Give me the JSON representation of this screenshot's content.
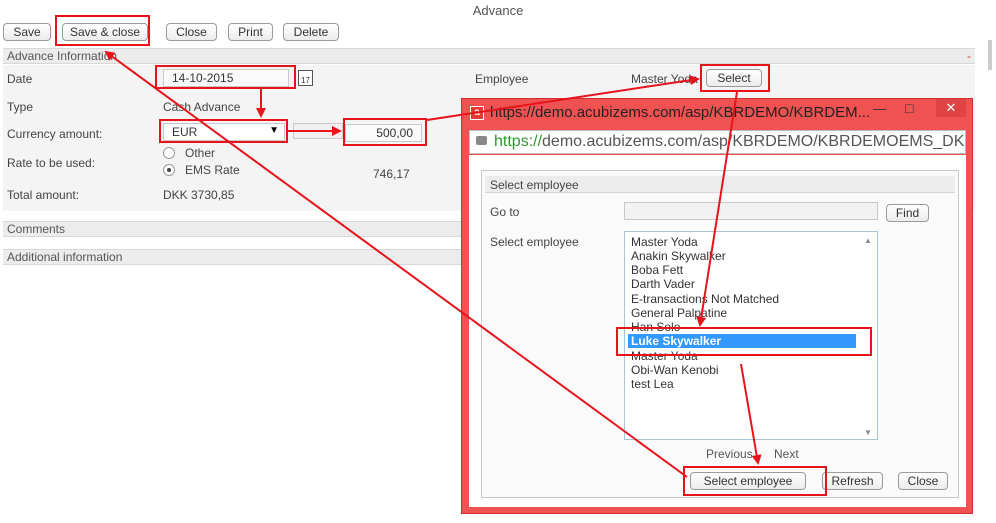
{
  "window": {
    "title": "Advance"
  },
  "toolbar": {
    "save": "Save",
    "save_close": "Save & close",
    "close": "Close",
    "print": "Print",
    "delete": "Delete"
  },
  "sections": {
    "advance_info": "Advance Information",
    "comments": "Comments",
    "additional_info": "Additional information",
    "collapse_symbol": "-"
  },
  "form": {
    "date_label": "Date",
    "date_value": "14-10-2015",
    "calendar_day": "17",
    "type_label": "Type",
    "type_value": "Cash Advance",
    "currency_label": "Currency amount:",
    "currency_value": "EUR",
    "amount_value": "500,00",
    "rate_label": "Rate to be used:",
    "rate_other": "Other",
    "rate_ems": "EMS Rate",
    "rate_value": "746,17",
    "total_label": "Total amount:",
    "total_value": "DKK 3730,85",
    "employee_label": "Employee",
    "employee_value": "Master Yoda",
    "select_button": "Select"
  },
  "popup": {
    "title": "https://demo.acubizems.com/asp/KBRDEMO/KBRDEM...",
    "url_https": "https://",
    "url_rest": "demo.acubizems.com/asp/KBRDEMO/KBRDEMOEMS_DK.ns",
    "minimize": "—",
    "maximize": "□",
    "close": "✕",
    "dialog_title": "Select employee",
    "goto_label": "Go to",
    "goto_value": "",
    "find_button": "Find",
    "select_label": "Select employee",
    "employees": [
      "Master Yoda",
      "Anakin Skywalker",
      "Boba Fett",
      "Darth Vader",
      "E-transactions Not Matched",
      "General Palpatine",
      "Han Solo",
      "Luke Skywalker",
      "Master Yoda",
      "Obi-Wan Kenobi",
      "test Lea"
    ],
    "selected_employee": "Luke Skywalker",
    "previous": "Previous",
    "next": "Next",
    "select_employee_button": "Select employee",
    "refresh_button": "Refresh",
    "close_button": "Close"
  },
  "colors": {
    "annotation": "#e8121a",
    "popup_frame": "#f05252",
    "selection": "#3399ff",
    "https_green": "#2e9a2e"
  }
}
